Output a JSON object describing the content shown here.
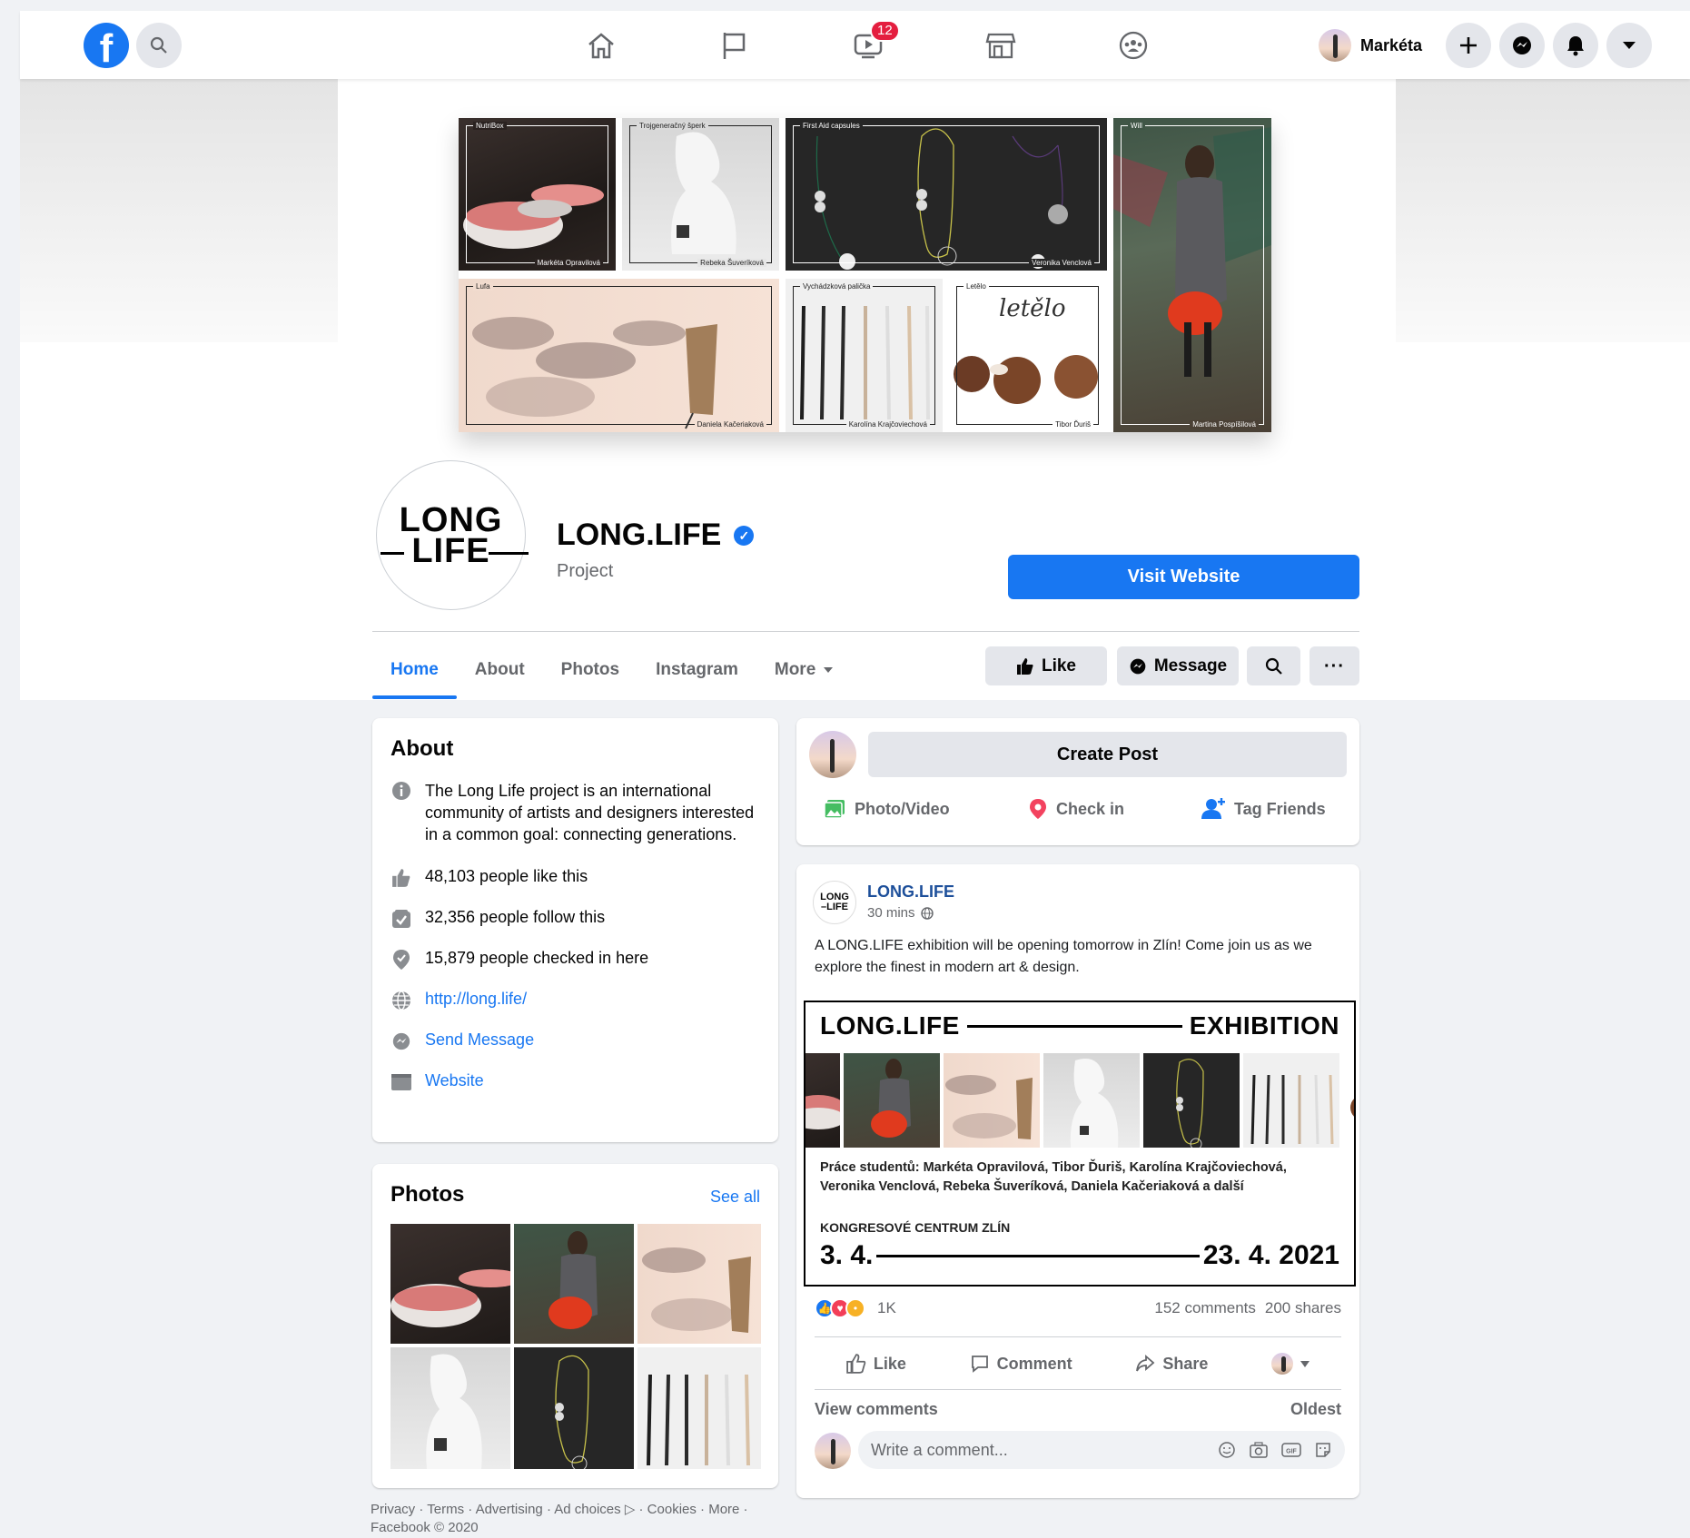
{
  "nav": {
    "logo": "f",
    "watch_badge": "12",
    "user_name": "Markéta"
  },
  "cover": {
    "tiles": [
      {
        "title": "NutriBox",
        "author": "Markéta Opravilová"
      },
      {
        "title": "Trojgeneračný šperk",
        "author": "Rebeka Šuveríková"
      },
      {
        "title": "First Aid capsules",
        "author": "Veronika Venclová"
      },
      {
        "title": "Will",
        "author": "Martina Pospíšilová"
      },
      {
        "title": "Lufa",
        "author": "Daniela Kačeriaková"
      },
      {
        "title": "Vychádzková palička",
        "author": "Karolína Krajčoviechová"
      },
      {
        "title": "Letělo",
        "author": "Tibor Ďuriš",
        "script": "letělo"
      }
    ]
  },
  "profile": {
    "logo_line1": "LONG",
    "logo_line2": "LIFE",
    "name": "LONG.LIFE",
    "category": "Project",
    "visit_website": "Visit Website"
  },
  "tabs": [
    "Home",
    "About",
    "Photos",
    "Instagram",
    "More"
  ],
  "actions": {
    "like": "Like",
    "message": "Message"
  },
  "about": {
    "heading": "About",
    "description": "The Long Life project is an international community of artists and designers inter­ested in a common goal: connecting gen­erations.",
    "likes": "48,103 people like this",
    "follows": "32,356 people follow this",
    "checkins": "15,879 people checked in here",
    "url": "http://long.life/",
    "send_message": "Send Message",
    "website": "Website"
  },
  "photos": {
    "heading": "Photos",
    "see_all": "See all"
  },
  "footer": "Privacy · Terms · Advertising · Ad choices ▷ · Cookies · More · Facebook © 2020",
  "composer": {
    "create_post": "Create Post",
    "photo_video": "Photo/Video",
    "check_in": "Check in",
    "tag_friends": "Tag Friends"
  },
  "post": {
    "author": "LONG.LIFE",
    "time": "30 mins",
    "text": "A LONG.LIFE exhibition will be opening tomorrow in Zlín! Come join us as we explore the finest in modern art & design.",
    "poster": {
      "title_left": "LONG.LIFE",
      "title_right": "EXHIBITION",
      "names_line1": "Práce studentů: Markéta Opravilová, Tibor Ďuriš, Karolína Krajčoviechová,",
      "names_line2": "Veronika Venclová, Rebeka Šuveríková, Daniela Kačeriaková a další",
      "venue": "KONGRESOVÉ CENTRUM ZLÍN",
      "date_from": "3. 4.",
      "date_to": "23. 4. 2021"
    },
    "reaction_count": "1K",
    "comments": "152 comments",
    "shares": "200 shares",
    "like": "Like",
    "comment": "Comment",
    "share": "Share",
    "view_comments": "View comments",
    "sort": "Oldest",
    "comment_placeholder": "Write a comment..."
  },
  "colors": {
    "accent": "#1877f2",
    "background": "#f0f2f5",
    "badge": "#e41e3f"
  }
}
